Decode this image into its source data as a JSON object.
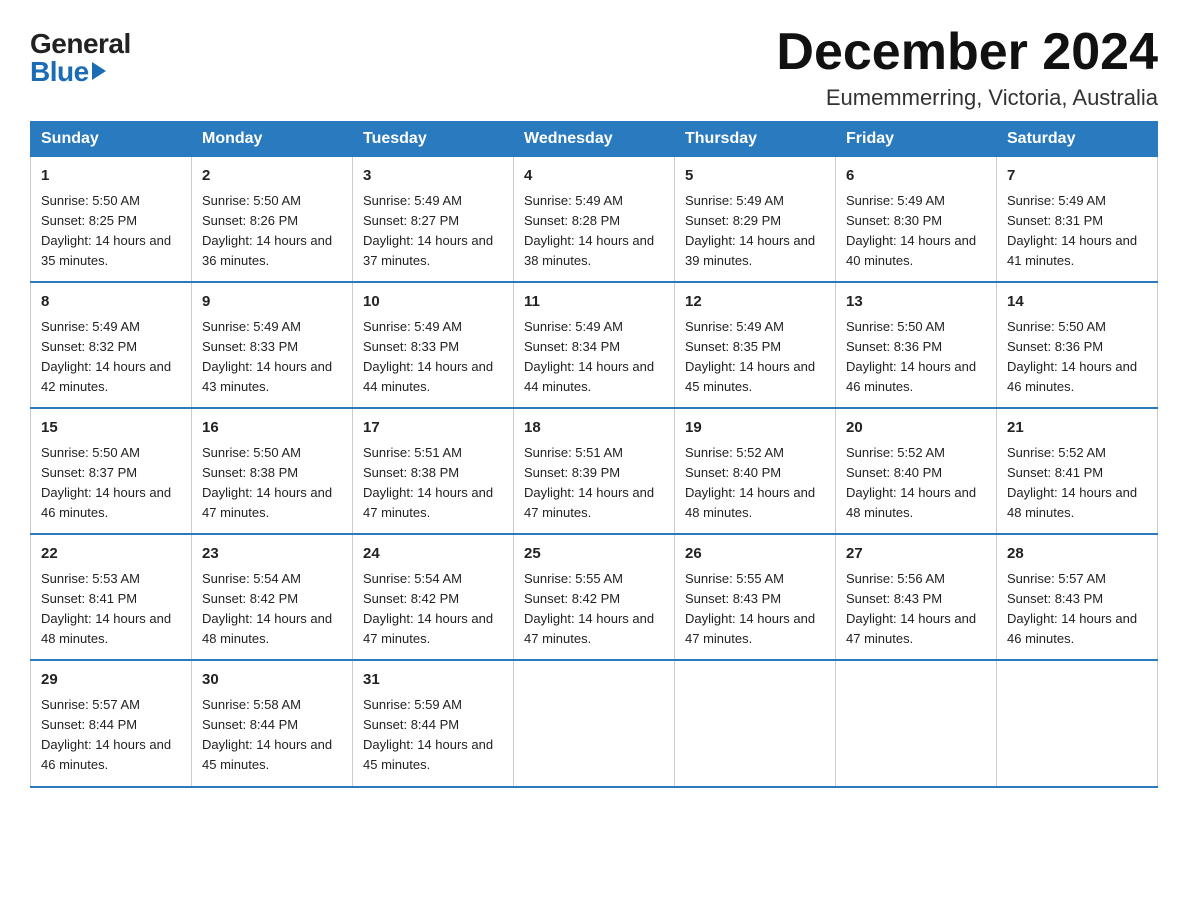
{
  "logo": {
    "general": "General",
    "blue": "Blue"
  },
  "header": {
    "month_year": "December 2024",
    "location": "Eumemmerring, Victoria, Australia"
  },
  "weekdays": [
    "Sunday",
    "Monday",
    "Tuesday",
    "Wednesday",
    "Thursday",
    "Friday",
    "Saturday"
  ],
  "weeks": [
    [
      {
        "day": "1",
        "sunrise": "5:50 AM",
        "sunset": "8:25 PM",
        "daylight": "14 hours and 35 minutes."
      },
      {
        "day": "2",
        "sunrise": "5:50 AM",
        "sunset": "8:26 PM",
        "daylight": "14 hours and 36 minutes."
      },
      {
        "day": "3",
        "sunrise": "5:49 AM",
        "sunset": "8:27 PM",
        "daylight": "14 hours and 37 minutes."
      },
      {
        "day": "4",
        "sunrise": "5:49 AM",
        "sunset": "8:28 PM",
        "daylight": "14 hours and 38 minutes."
      },
      {
        "day": "5",
        "sunrise": "5:49 AM",
        "sunset": "8:29 PM",
        "daylight": "14 hours and 39 minutes."
      },
      {
        "day": "6",
        "sunrise": "5:49 AM",
        "sunset": "8:30 PM",
        "daylight": "14 hours and 40 minutes."
      },
      {
        "day": "7",
        "sunrise": "5:49 AM",
        "sunset": "8:31 PM",
        "daylight": "14 hours and 41 minutes."
      }
    ],
    [
      {
        "day": "8",
        "sunrise": "5:49 AM",
        "sunset": "8:32 PM",
        "daylight": "14 hours and 42 minutes."
      },
      {
        "day": "9",
        "sunrise": "5:49 AM",
        "sunset": "8:33 PM",
        "daylight": "14 hours and 43 minutes."
      },
      {
        "day": "10",
        "sunrise": "5:49 AM",
        "sunset": "8:33 PM",
        "daylight": "14 hours and 44 minutes."
      },
      {
        "day": "11",
        "sunrise": "5:49 AM",
        "sunset": "8:34 PM",
        "daylight": "14 hours and 44 minutes."
      },
      {
        "day": "12",
        "sunrise": "5:49 AM",
        "sunset": "8:35 PM",
        "daylight": "14 hours and 45 minutes."
      },
      {
        "day": "13",
        "sunrise": "5:50 AM",
        "sunset": "8:36 PM",
        "daylight": "14 hours and 46 minutes."
      },
      {
        "day": "14",
        "sunrise": "5:50 AM",
        "sunset": "8:36 PM",
        "daylight": "14 hours and 46 minutes."
      }
    ],
    [
      {
        "day": "15",
        "sunrise": "5:50 AM",
        "sunset": "8:37 PM",
        "daylight": "14 hours and 46 minutes."
      },
      {
        "day": "16",
        "sunrise": "5:50 AM",
        "sunset": "8:38 PM",
        "daylight": "14 hours and 47 minutes."
      },
      {
        "day": "17",
        "sunrise": "5:51 AM",
        "sunset": "8:38 PM",
        "daylight": "14 hours and 47 minutes."
      },
      {
        "day": "18",
        "sunrise": "5:51 AM",
        "sunset": "8:39 PM",
        "daylight": "14 hours and 47 minutes."
      },
      {
        "day": "19",
        "sunrise": "5:52 AM",
        "sunset": "8:40 PM",
        "daylight": "14 hours and 48 minutes."
      },
      {
        "day": "20",
        "sunrise": "5:52 AM",
        "sunset": "8:40 PM",
        "daylight": "14 hours and 48 minutes."
      },
      {
        "day": "21",
        "sunrise": "5:52 AM",
        "sunset": "8:41 PM",
        "daylight": "14 hours and 48 minutes."
      }
    ],
    [
      {
        "day": "22",
        "sunrise": "5:53 AM",
        "sunset": "8:41 PM",
        "daylight": "14 hours and 48 minutes."
      },
      {
        "day": "23",
        "sunrise": "5:54 AM",
        "sunset": "8:42 PM",
        "daylight": "14 hours and 48 minutes."
      },
      {
        "day": "24",
        "sunrise": "5:54 AM",
        "sunset": "8:42 PM",
        "daylight": "14 hours and 47 minutes."
      },
      {
        "day": "25",
        "sunrise": "5:55 AM",
        "sunset": "8:42 PM",
        "daylight": "14 hours and 47 minutes."
      },
      {
        "day": "26",
        "sunrise": "5:55 AM",
        "sunset": "8:43 PM",
        "daylight": "14 hours and 47 minutes."
      },
      {
        "day": "27",
        "sunrise": "5:56 AM",
        "sunset": "8:43 PM",
        "daylight": "14 hours and 47 minutes."
      },
      {
        "day": "28",
        "sunrise": "5:57 AM",
        "sunset": "8:43 PM",
        "daylight": "14 hours and 46 minutes."
      }
    ],
    [
      {
        "day": "29",
        "sunrise": "5:57 AM",
        "sunset": "8:44 PM",
        "daylight": "14 hours and 46 minutes."
      },
      {
        "day": "30",
        "sunrise": "5:58 AM",
        "sunset": "8:44 PM",
        "daylight": "14 hours and 45 minutes."
      },
      {
        "day": "31",
        "sunrise": "5:59 AM",
        "sunset": "8:44 PM",
        "daylight": "14 hours and 45 minutes."
      },
      null,
      null,
      null,
      null
    ]
  ]
}
